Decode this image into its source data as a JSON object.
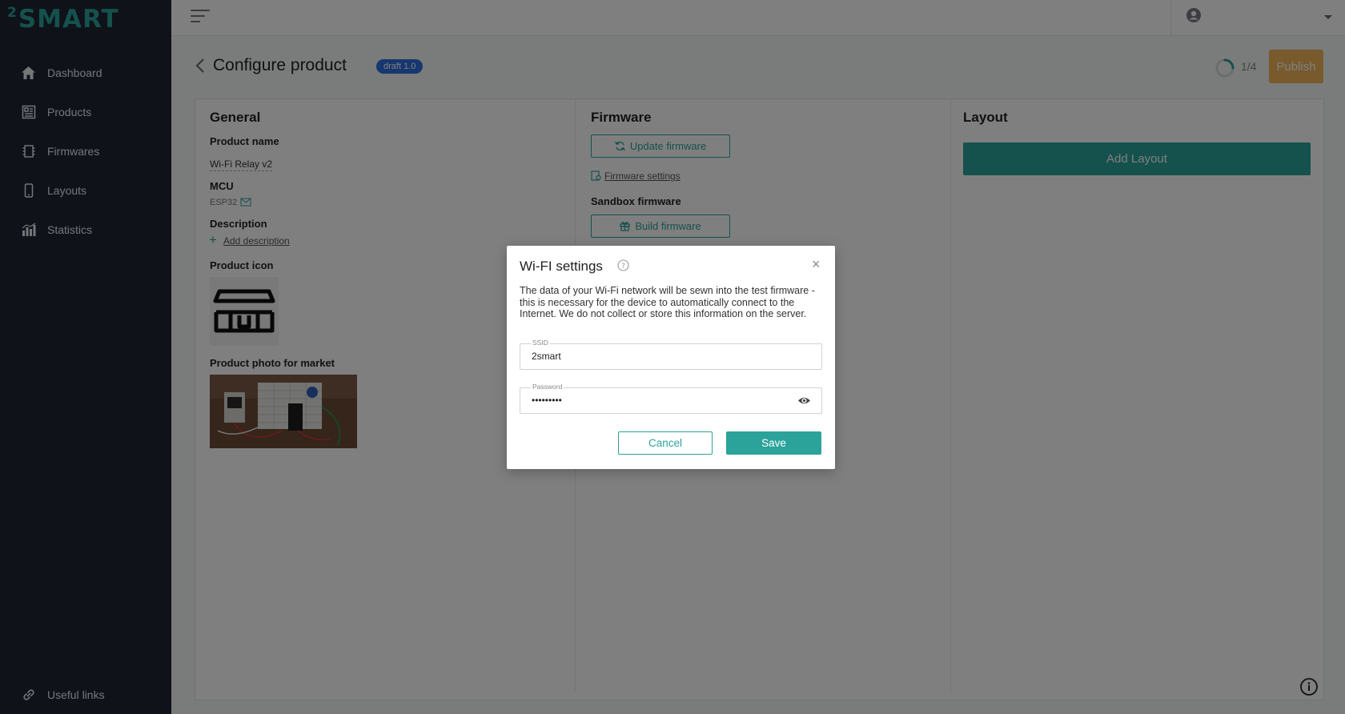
{
  "brand": {
    "logo_sup": "2",
    "logo_text": "SMART",
    "accent": "#2ba39a"
  },
  "sidebar": {
    "items": [
      {
        "label": "Dashboard",
        "icon": "home-icon"
      },
      {
        "label": "Products",
        "icon": "products-icon"
      },
      {
        "label": "Firmwares",
        "icon": "firmware-icon"
      },
      {
        "label": "Layouts",
        "icon": "phone-icon"
      },
      {
        "label": "Statistics",
        "icon": "chart-icon"
      }
    ],
    "bottom_item": {
      "label": "Useful links",
      "icon": "link-icon"
    }
  },
  "header": {
    "title": "Configure product",
    "badge": "draft 1.0",
    "progress": "1/4",
    "progress_value": 0.25,
    "publish_label": "Publish"
  },
  "general": {
    "title": "General",
    "product_name_label": "Product name",
    "product_name": "Wi-Fi Relay v2",
    "mcu_label": "MCU",
    "mcu_value": "ESP32",
    "description_label": "Description",
    "add_description": "Add description",
    "product_icon_label": "Product icon",
    "photo_label": "Product photo for market"
  },
  "firmware": {
    "title": "Firmware",
    "update_label": "Update firmware",
    "settings_link": "Firmware settings",
    "sandbox_label": "Sandbox firmware",
    "build_label": "Build firmware"
  },
  "layout": {
    "title": "Layout",
    "add_label": "Add Layout"
  },
  "modal": {
    "title": "Wi-FI settings",
    "description": "The data of your Wi-Fi network will be sewn into the test firmware - this is necessary for the device to automatically connect to the Internet. We do not collect or store this information on the server.",
    "ssid_label": "SSID",
    "ssid_value": "2smart",
    "password_label": "Password",
    "password_value": "•••••••••",
    "cancel_label": "Cancel",
    "save_label": "Save"
  }
}
